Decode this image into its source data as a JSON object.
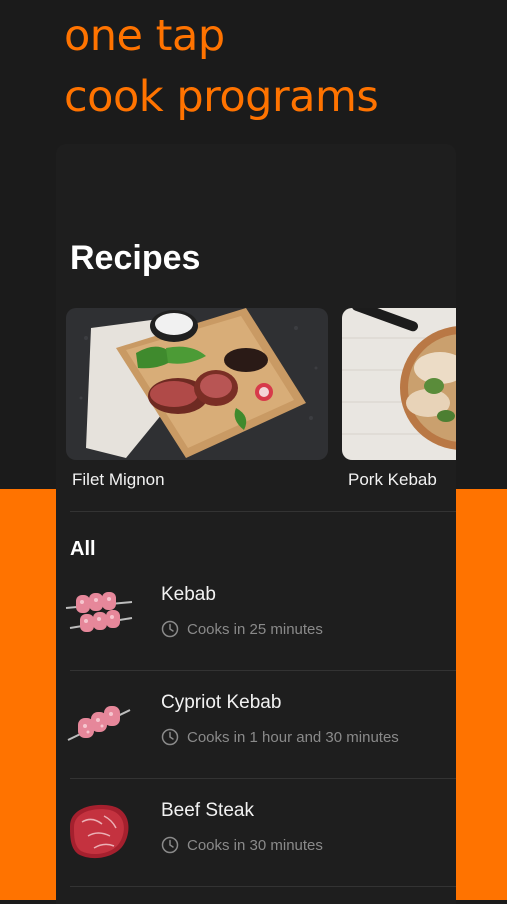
{
  "hero": {
    "line1": "one tap",
    "line2": "cook programs"
  },
  "colors": {
    "accent": "#ff7300",
    "background": "#1b1b1b",
    "card": "#1e1e1e",
    "muted_text": "#8a8a8a"
  },
  "recipes": {
    "title": "Recipes",
    "featured": [
      {
        "name": "Filet Mignon",
        "image": "steak-on-board-photo"
      },
      {
        "name": "Pork Kebab",
        "image": "kebab-skewers-photo"
      }
    ]
  },
  "all_section": {
    "title": "All",
    "items": [
      {
        "title": "Kebab",
        "meta": "Cooks in 25 minutes",
        "icon": "raw-kebab-skewer-icon"
      },
      {
        "title": "Cypriot Kebab",
        "meta": "Cooks in 1 hour and 30 minutes",
        "icon": "raw-kebab-skewer-icon"
      },
      {
        "title": "Beef Steak",
        "meta": "Cooks in 30 minutes",
        "icon": "raw-steak-icon"
      }
    ]
  }
}
